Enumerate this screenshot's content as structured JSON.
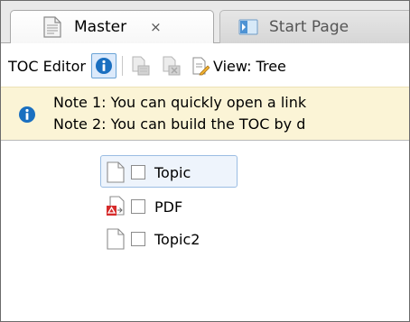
{
  "tabs": [
    {
      "label": "Master",
      "close": "×",
      "icon": "document-icon"
    },
    {
      "label": "Start Page",
      "icon": "start-page-icon"
    }
  ],
  "toolbar": {
    "label": "TOC Editor",
    "view_label": "View: Tree"
  },
  "notes": {
    "note1": "Note 1: You can quickly open a link",
    "note2": "Note 2: You can build the TOC by d"
  },
  "tree": {
    "items": [
      {
        "label": "Topic",
        "icon": "topic-document-icon",
        "selected": true
      },
      {
        "label": "PDF",
        "icon": "pdf-document-icon",
        "selected": false
      },
      {
        "label": "Topic2",
        "icon": "topic-document-icon",
        "selected": false
      }
    ]
  },
  "colors": {
    "info_blue": "#1a6fc0",
    "banner": "#fbf4d6",
    "selection": "#eef4fc",
    "pdf_red": "#d62b2b"
  }
}
